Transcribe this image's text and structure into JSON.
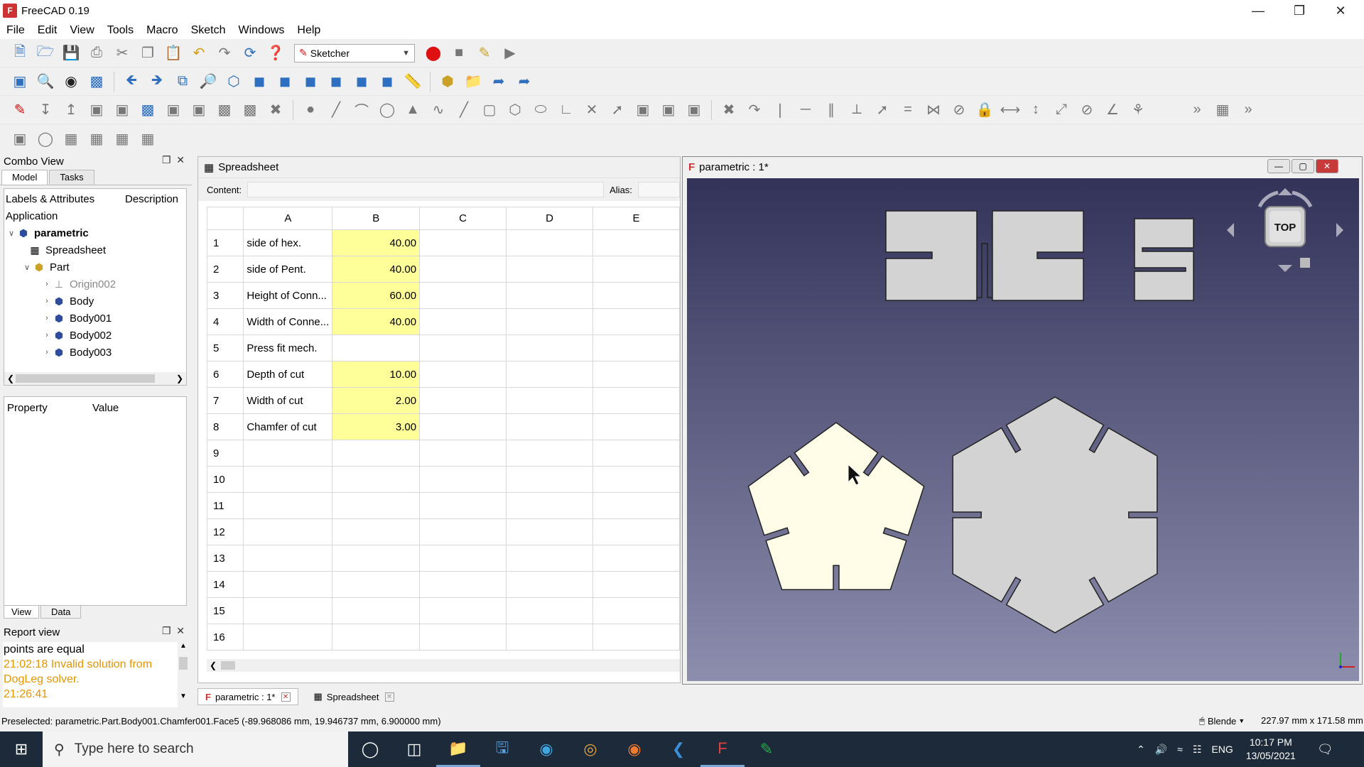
{
  "window": {
    "title": "FreeCAD 0.19"
  },
  "menu": [
    "File",
    "Edit",
    "View",
    "Tools",
    "Macro",
    "Sketch",
    "Windows",
    "Help"
  ],
  "workbench": {
    "selected": "Sketcher"
  },
  "combo_view": {
    "title": "Combo View",
    "tabs": [
      "Model",
      "Tasks"
    ],
    "tree_headers": [
      "Labels & Attributes",
      "Description"
    ],
    "application_label": "Application",
    "tree": [
      {
        "label": "parametric",
        "level": 0,
        "bold": true
      },
      {
        "label": "Spreadsheet",
        "level": 1
      },
      {
        "label": "Part",
        "level": 1
      },
      {
        "label": "Origin002",
        "level": 2,
        "muted": true
      },
      {
        "label": "Body",
        "level": 2
      },
      {
        "label": "Body001",
        "level": 2
      },
      {
        "label": "Body002",
        "level": 2
      },
      {
        "label": "Body003",
        "level": 2
      }
    ],
    "property_headers": [
      "Property",
      "Value"
    ],
    "bottom_tabs": [
      "View",
      "Data"
    ]
  },
  "report_view": {
    "title": "Report view",
    "lines": [
      {
        "text": "points are equal",
        "color": "#000000"
      },
      {
        "text": "21:02:18  Invalid solution from",
        "color": "#e69500"
      },
      {
        "text": "DogLeg solver.",
        "color": "#e69500"
      },
      {
        "text": "21:26:41",
        "color": "#e69500"
      }
    ]
  },
  "spreadsheet": {
    "title": "Spreadsheet",
    "content_label": "Content:",
    "alias_label": "Alias:",
    "columns": [
      "A",
      "B",
      "C",
      "D",
      "E"
    ],
    "rows": [
      {
        "n": "1",
        "a": "side of hex.",
        "b": "40.00"
      },
      {
        "n": "2",
        "a": "side of Pent.",
        "b": "40.00"
      },
      {
        "n": "3",
        "a": "Height of Conn...",
        "b": "60.00"
      },
      {
        "n": "4",
        "a": "Width of Conne...",
        "b": "40.00"
      },
      {
        "n": "5",
        "a": "Press fit mech.",
        "b": ""
      },
      {
        "n": "6",
        "a": "Depth of cut",
        "b": "10.00"
      },
      {
        "n": "7",
        "a": "Width of cut",
        "b": "2.00"
      },
      {
        "n": "8",
        "a": "Chamfer of cut",
        "b": "3.00"
      },
      {
        "n": "9",
        "a": "",
        "b": ""
      },
      {
        "n": "10",
        "a": "",
        "b": ""
      },
      {
        "n": "11",
        "a": "",
        "b": ""
      },
      {
        "n": "12",
        "a": "",
        "b": ""
      },
      {
        "n": "13",
        "a": "",
        "b": ""
      },
      {
        "n": "14",
        "a": "",
        "b": ""
      },
      {
        "n": "15",
        "a": "",
        "b": ""
      },
      {
        "n": "16",
        "a": "",
        "b": ""
      }
    ]
  },
  "view3d": {
    "title": "parametric : 1*",
    "navcube_label": "TOP",
    "selected_color": "#fffde8",
    "part_color": "#d3d3d3"
  },
  "doc_tabs": [
    "parametric : 1*",
    "Spreadsheet"
  ],
  "status": {
    "preselected": "Preselected: parametric.Part.Body001.Chamfer001.Face5 (-89.968086 mm, 19.946737 mm, 6.900000 mm)",
    "nav_style": "Blende",
    "dimensions": "227.97 mm x 171.58 mm"
  },
  "taskbar": {
    "search_placeholder": "Type here to search",
    "language": "ENG",
    "time": "10:17 PM",
    "date": "13/05/2021"
  }
}
